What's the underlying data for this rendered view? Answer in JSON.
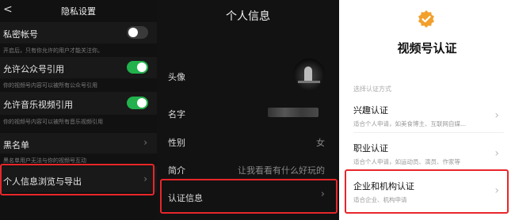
{
  "privacy": {
    "title": "隐私设置",
    "back_label": "<",
    "items": [
      {
        "label": "私密帐号",
        "hint": "开启后，只有你允许的用户才能关注你。",
        "toggle": "off"
      },
      {
        "label": "允许公众号引用",
        "hint": "你的视频号内容可以被所有公众号引用",
        "toggle": "on"
      },
      {
        "label": "允许音乐视频引用",
        "hint": "你的视频号内容可以被所有音乐视频引用",
        "toggle": "on"
      },
      {
        "label": "黑名单",
        "hint": "黑名单用户无法与你的视频号互动"
      },
      {
        "label": "个人信息浏览与导出"
      }
    ],
    "chevron": "›"
  },
  "profile": {
    "title": "个人信息",
    "rows": [
      {
        "label": "头像"
      },
      {
        "label": "名字"
      },
      {
        "label": "性别",
        "value": "女"
      },
      {
        "label": "简介",
        "value": "让我看看有什么好玩的"
      },
      {
        "label": "认证信息"
      }
    ],
    "chevron": "›"
  },
  "verify": {
    "title": "视频号认证",
    "section_label": "选择认证方式",
    "options": [
      {
        "title": "兴趣认证",
        "sub": "适合个人申请，如美食博主、互联网自媒..."
      },
      {
        "title": "职业认证",
        "sub": "适合个人申请，如运动员、演员、作家等"
      },
      {
        "title": "企业和机构认证",
        "sub": "适合企业、机构申请"
      }
    ],
    "chevron": "›",
    "badge_icon": "verified-check-badge"
  },
  "colors": {
    "highlight": "#e8262a",
    "toggle_on": "#22b14c",
    "badge": "#f2a02c"
  }
}
